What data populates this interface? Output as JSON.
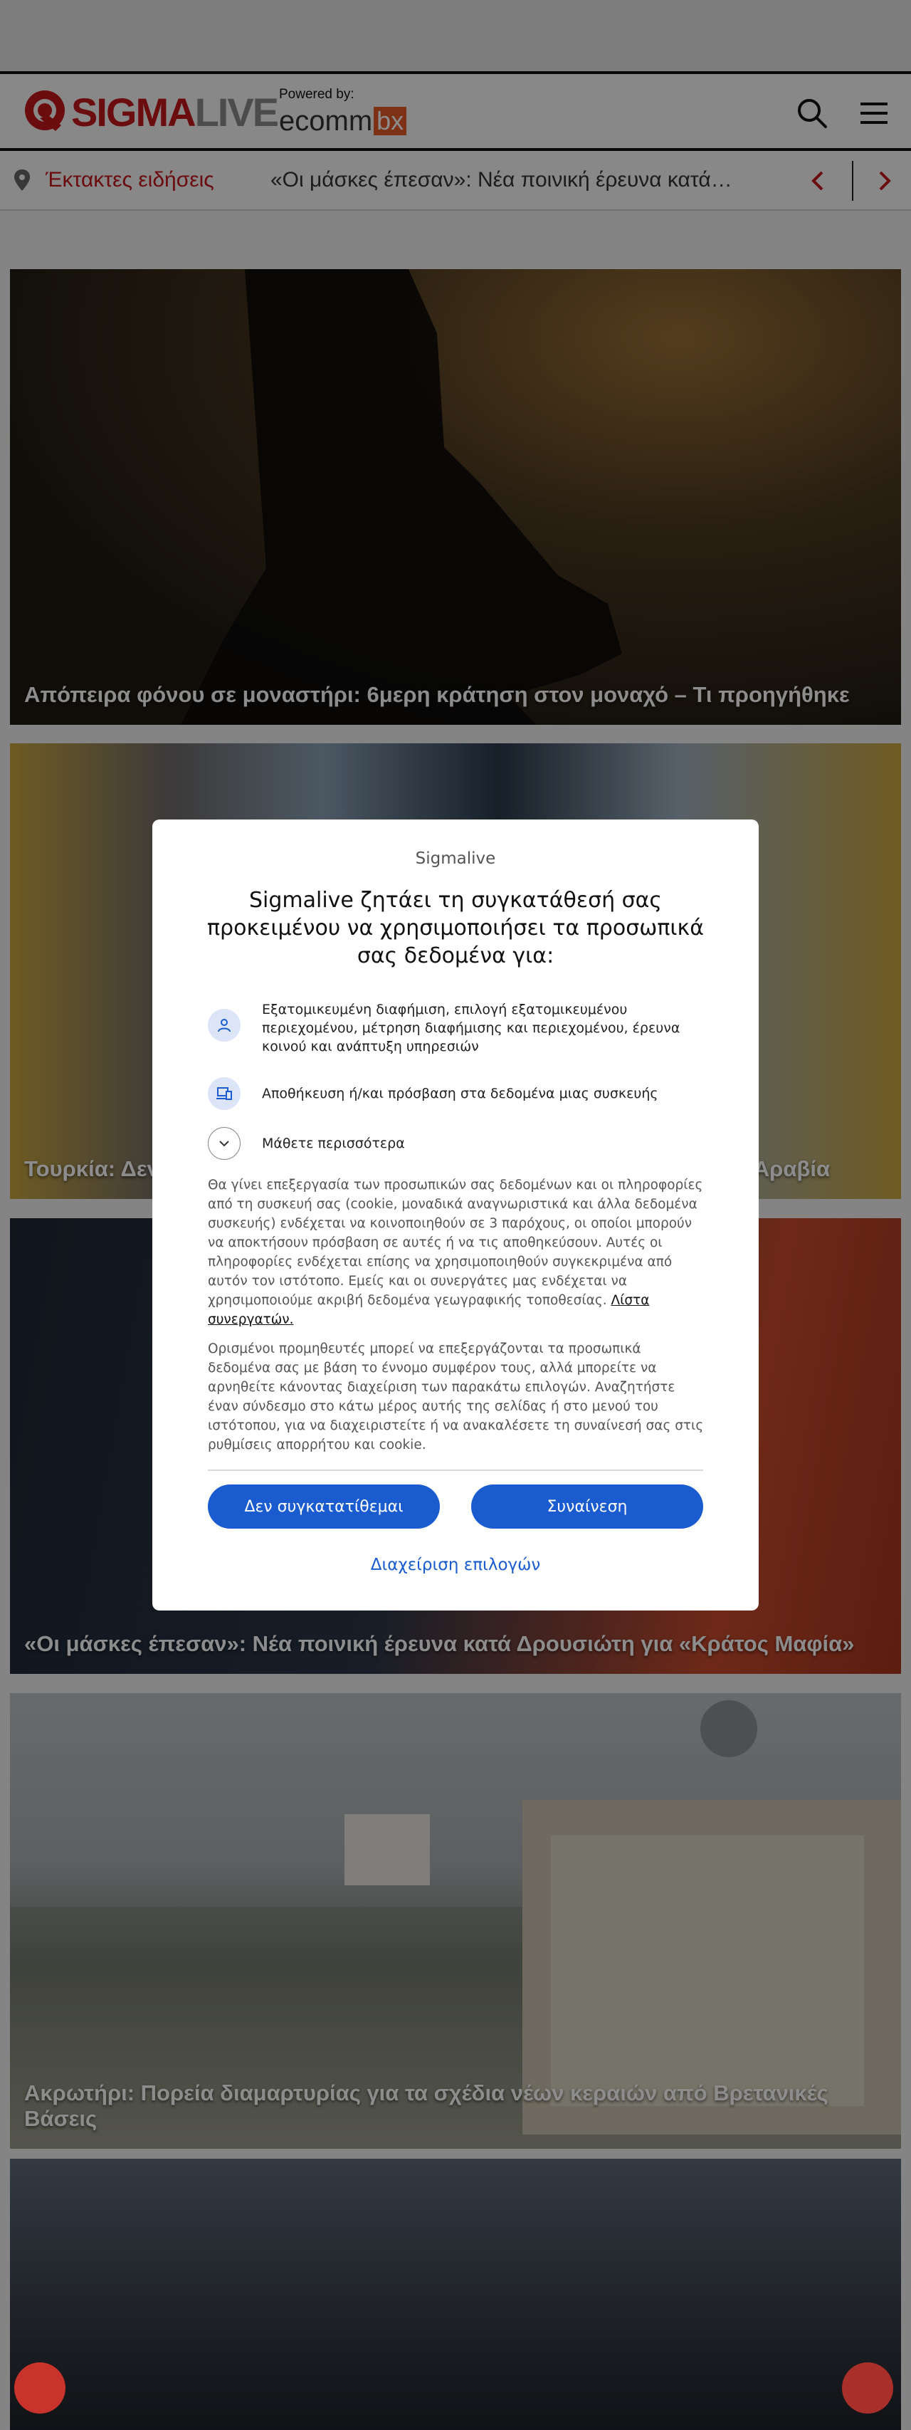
{
  "header": {
    "logo": {
      "part1": "SIGMA",
      "part2": "LIVE"
    },
    "powered_by_label": "Powered by:",
    "sponsor": {
      "part1": "ecomm",
      "part2": "bx"
    },
    "icons": {
      "search": "search-icon",
      "menu": "hamburger-menu-icon"
    }
  },
  "breaking": {
    "label": "Έκτακτες ειδήσεις",
    "headline": "«Οι μάσκες έπεσαν»: Νέα ποινική έρευνα κατά…",
    "icons": {
      "pin": "location-pin-icon",
      "prev": "chevron-left-icon",
      "next": "chevron-right-icon"
    }
  },
  "articles": [
    {
      "headline": "Απόπειρα φόνου σε μοναστήρι: 6μερη κράτηση στον μοναχό – Τι προηγήθηκε"
    },
    {
      "headline": "Τουρκία: Δεν",
      "headline_tail": "Αραβία"
    },
    {
      "headline": "«Οι μάσκες έπεσαν»: Νέα ποινική έρευνα κατά Δρουσιώτη για «Κράτος Μαφία»"
    },
    {
      "headline": "Ακρωτήρι: Πορεία διαμαρτυρίας για τα σχέδια νέων κεραιών από Βρετανικές Βάσεις"
    },
    {
      "headline": ""
    }
  ],
  "consent": {
    "brand": "Sigmalive",
    "title": "Sigmalive ζητάει τη συγκατάθεσή σας προκειμένου να χρησιμοποιήσει τα προσωπικά σας δεδομένα για:",
    "purposes": [
      {
        "icon": "person-icon",
        "text": "Εξατομικευμένη διαφήμιση, επιλογή εξατομικευμένου περιεχομένου, μέτρηση διαφήμισης και περιεχομένου, έρευνα κοινού και ανάπτυξη υπηρεσιών"
      },
      {
        "icon": "devices-icon",
        "text": "Αποθήκευση ή/και πρόσβαση στα δεδομένα μιας συσκευής"
      },
      {
        "icon": "chevron-down-icon",
        "text": "Μάθετε περισσότερα"
      }
    ],
    "paragraph1": "Θα γίνει επεξεργασία των προσωπικών σας δεδομένων και οι πληροφορίες από τη συσκευή σας (cookie, μοναδικά αναγνωριστικά και άλλα δεδομένα συσκευής) ενδέχεται να κοινοποιηθούν σε 3 παρόχους, οι οποίοι μπορούν να αποκτήσουν πρόσβαση σε αυτές ή να τις αποθηκεύσουν. Αυτές οι πληροφορίες ενδέχεται επίσης να χρησιμοποιηθούν συγκεκριμένα από αυτόν τον ιστότοπο. Εμείς και οι συνεργάτες μας ενδέχεται να χρησιμοποιούμε ακριβή δεδομένα γεωγραφικής τοποθεσίας. ",
    "partners_link": "Λίστα συνεργατών.",
    "paragraph2": "Ορισμένοι προμηθευτές μπορεί να επεξεργάζονται τα προσωπικά δεδομένα σας με βάση το έννομο συμφέρον τους, αλλά μπορείτε να αρνηθείτε κάνοντας διαχείριση των παρακάτω επιλογών. Αναζητήστε έναν σύνδεσμο στο κάτω μέρος αυτής της σελίδας ή στο μενού του ιστότοπου, για να διαχειριστείτε ή να ανακαλέσετε τη συναίνεσή σας στις ρυθμίσεις απορρήτου και cookie.",
    "decline_label": "Δεν συγκατατίθεμαι",
    "accept_label": "Συναίνεση",
    "manage_label": "Διαχείριση επιλογών"
  },
  "floating": {
    "left_icon": "accessibility-icon",
    "right_icon": "chat-icon"
  },
  "colors": {
    "brand_red": "#c4161c",
    "consent_blue": "#1a5ccf",
    "sponsor_orange": "#e35a2a"
  }
}
